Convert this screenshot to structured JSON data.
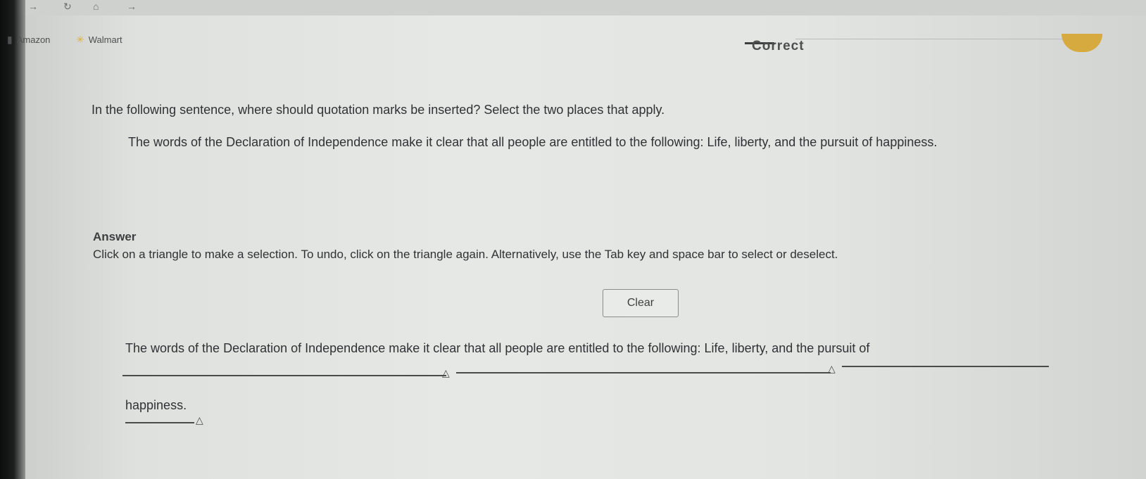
{
  "browser": {
    "bookmarks": [
      {
        "label": "Amazon",
        "icon": "amazon-icon"
      },
      {
        "label": "Walmart",
        "icon": "walmart-spark-icon"
      }
    ]
  },
  "status": {
    "label": "Correct"
  },
  "question": {
    "prompt": "In the following sentence, where should quotation marks be inserted? Select the two places that apply.",
    "sentence": "The words of the Declaration of Independence make it clear that all people are entitled to the following: Life, liberty, and the pursuit of happiness."
  },
  "answer": {
    "heading": "Answer",
    "instructions": "Click on a triangle to make a selection. To undo, click on the triangle again. Alternatively, use the Tab key and space bar to select or deselect.",
    "clear_label": "Clear",
    "segments": [
      "The words of the Declaration of Independence",
      "make it clear that all people are entitled to the following:",
      "Life, liberty, and the pursuit of",
      "happiness."
    ],
    "triangle_glyph": "△"
  },
  "colors": {
    "accent_gold": "#d7aa3f",
    "text": "#2f3234"
  }
}
